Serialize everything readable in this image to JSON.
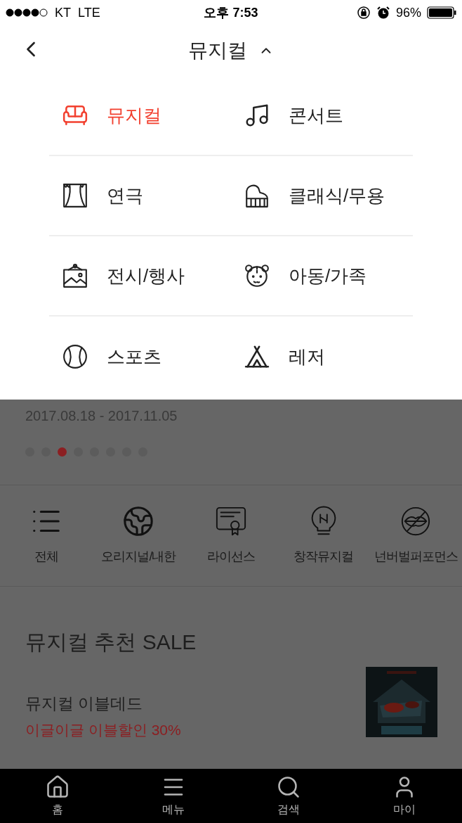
{
  "status_bar": {
    "carrier": "KT",
    "network": "LTE",
    "time": "오후 7:53",
    "battery": "96%"
  },
  "header": {
    "title": "뮤지컬",
    "expanded": true
  },
  "categories": [
    {
      "label": "뮤지컬",
      "selected": true
    },
    {
      "label": "콘서트",
      "selected": false
    },
    {
      "label": "연극",
      "selected": false
    },
    {
      "label": "클래식/무용",
      "selected": false
    },
    {
      "label": "전시/행사",
      "selected": false
    },
    {
      "label": "아동/가족",
      "selected": false
    },
    {
      "label": "스포츠",
      "selected": false
    },
    {
      "label": "레저",
      "selected": false
    }
  ],
  "banner": {
    "period": "2017.08.18  - 2017.11.05",
    "dots": [
      {
        "selected": false
      },
      {
        "selected": false
      },
      {
        "selected": true
      },
      {
        "selected": false
      },
      {
        "selected": false
      },
      {
        "selected": false
      },
      {
        "selected": false
      },
      {
        "selected": false
      }
    ]
  },
  "genres": [
    "전체",
    "오리지널/내한",
    "라이선스",
    "창작뮤지컬",
    "넌버벌퍼포먼스"
  ],
  "sale": {
    "title": "뮤지컬 추천 SALE",
    "items": [
      {
        "title": "뮤지컬 이블데드",
        "discount": "이글이글 이블할인 30%"
      }
    ]
  },
  "tab_bar": [
    "홈",
    "메뉴",
    "검색",
    "마이"
  ]
}
